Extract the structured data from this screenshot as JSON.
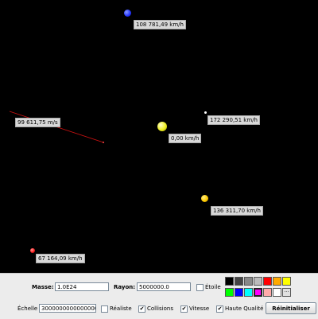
{
  "canvas": {
    "bodies": [
      {
        "name": "blue-planet",
        "color": "#2233ff",
        "speed_label": "108 781,49 km/h"
      },
      {
        "name": "white-planet",
        "color": "#ffffff",
        "speed_label": "172 290,51 km/h"
      },
      {
        "name": "sun",
        "color": "#eeee22",
        "speed_label": "0,00 km/h"
      },
      {
        "name": "yellow-planet",
        "color": "#ffcc00",
        "speed_label": "136 311,70 km/h"
      },
      {
        "name": "red-planet",
        "color": "#ff2222",
        "speed_label": "67 164,09 km/h"
      }
    ],
    "drag_vector": {
      "label": "99 611,75 m/s",
      "color": "#cc1111"
    }
  },
  "panel": {
    "mass_label": "Masse:",
    "mass_value": "1.0E24",
    "radius_label": "Rayon:",
    "radius_value": "5000000.0",
    "star_label": "Étoile",
    "scale_label": "Échelle",
    "scale_value": "3000000000000000005",
    "realistic_label": "Réaliste",
    "collisions_label": "Collisions",
    "speed_label": "Vitesse",
    "hq_label": "Haute Qualité",
    "reset_label": "Réinitialiser",
    "more_colors_label": "...",
    "palette": [
      "#000000",
      "#444444",
      "#888888",
      "#bbbbbb",
      "#ff0000",
      "#ffaa00",
      "#ffff00",
      "#00ff00",
      "#0000ff",
      "#00ffff",
      "#ff00ff",
      "#ffaaaa",
      "#ffffff"
    ]
  }
}
